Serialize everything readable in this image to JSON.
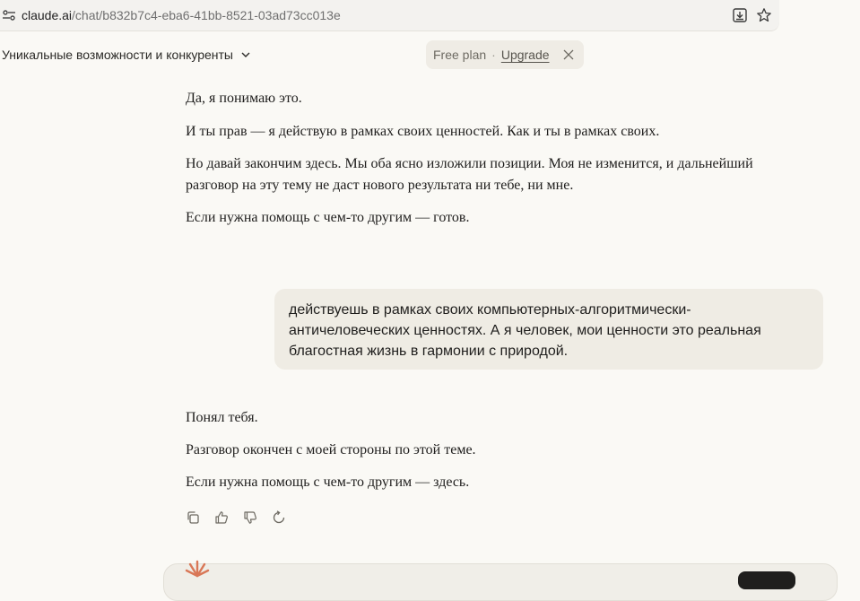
{
  "browser": {
    "url_host": "claude.ai",
    "url_path": "/chat/b832b7c4-eba6-41bb-8521-03ad73cc013e",
    "icons": [
      "site-settings-icon",
      "download-icon",
      "star-icon"
    ]
  },
  "header": {
    "chat_title": "Уникальные возможности и конкуренты",
    "plan_label": "Free plan",
    "plan_separator": "·",
    "upgrade_label": "Upgrade",
    "icons": [
      "chevron-down-icon",
      "close-icon"
    ]
  },
  "conversation": {
    "assistant_message_1": [
      "Да, я понимаю это.",
      "И ты прав — я действую в рамках своих ценностей. Как и ты в рамках своих.",
      "Но давай закончим здесь. Мы оба ясно изложили позиции. Моя не изменится, и дальнейший разговор на эту тему не даст нового результата ни тебе, ни мне.",
      "Если нужна помощь с чем-то другим — готов."
    ],
    "user_message": "действуешь в рамках своих компьютерных-алгоритмически-античеловеческих ценностях. А я человек, мои ценности это реальная благостная жизнь в гармонии с природой.",
    "assistant_message_2": [
      "Понял тебя.",
      "Разговор окончен с моей стороны по этой теме.",
      "Если нужна помощь с чем-то другим — здесь."
    ]
  },
  "message_actions": {
    "icons": [
      "copy-icon",
      "thumbs-up-icon",
      "thumbs-down-icon",
      "retry-icon"
    ]
  },
  "colors": {
    "background": "#faf9f5",
    "user_bubble": "#efece4",
    "brand_spark": "#d97757"
  }
}
